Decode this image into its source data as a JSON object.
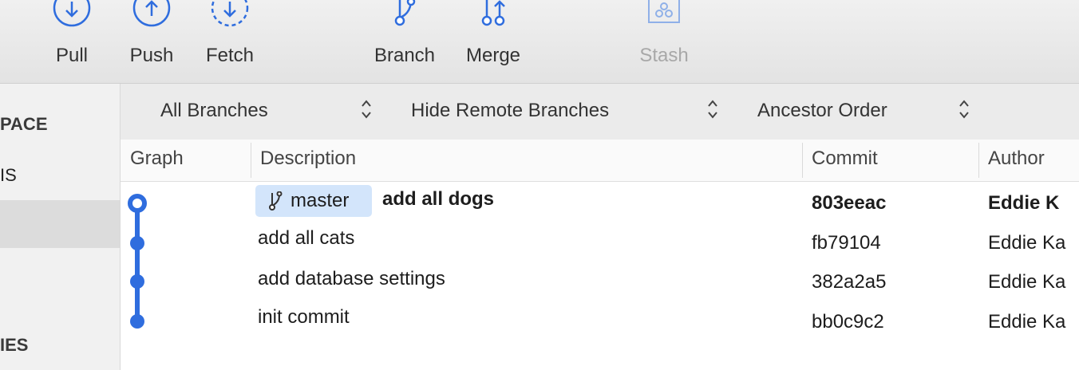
{
  "toolbar": {
    "pull_label": "Pull",
    "push_label": "Push",
    "fetch_label": "Fetch",
    "branch_label": "Branch",
    "merge_label": "Merge",
    "stash_label": "Stash"
  },
  "sidebar": {
    "section1": "PACE",
    "item1": "IS",
    "section2": "IES"
  },
  "filters": {
    "branches": "All Branches",
    "remote": "Hide Remote Branches",
    "order": "Ancestor Order"
  },
  "columns": {
    "graph": "Graph",
    "description": "Description",
    "commit": "Commit",
    "author": "Author"
  },
  "branch_tag": "master",
  "commits": [
    {
      "description": "add all dogs",
      "hash": "803eeac",
      "author": "Eddie K"
    },
    {
      "description": "add all cats",
      "hash": "fb79104",
      "author": "Eddie Ka"
    },
    {
      "description": "add database settings",
      "hash": "382a2a5",
      "author": "Eddie Ka"
    },
    {
      "description": "init commit",
      "hash": "bb0c9c2",
      "author": "Eddie Ka"
    }
  ],
  "colors": {
    "accent": "#2f6dde",
    "branch_tag_bg": "#d3e5fb"
  },
  "icons": {
    "pull": "arrow-down-circle-icon",
    "push": "arrow-up-circle-icon",
    "fetch": "dashed-arrow-down-circle-icon",
    "branch": "branch-icon",
    "merge": "merge-icon",
    "stash": "stash-icon",
    "updown": "up-down-chevron-icon"
  }
}
